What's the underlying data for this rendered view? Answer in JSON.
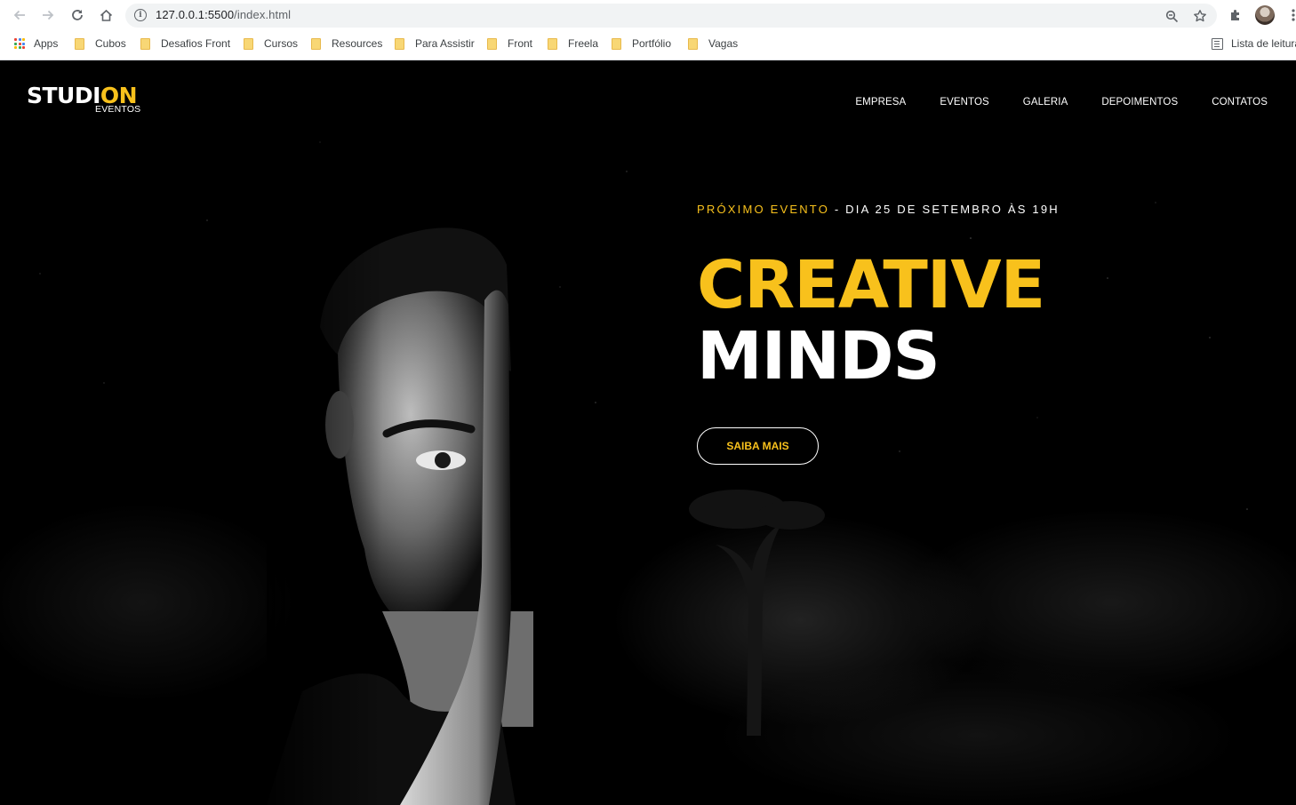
{
  "browser": {
    "url_host": "127.0.0.1:5500",
    "url_path": "/index.html",
    "bookmarks": [
      {
        "label": "Apps",
        "icon": "apps-grid-icon"
      },
      {
        "label": "Cubos",
        "icon": "folder-icon"
      },
      {
        "label": "Desafios Front",
        "icon": "folder-icon"
      },
      {
        "label": "Cursos",
        "icon": "folder-icon"
      },
      {
        "label": "Resources",
        "icon": "folder-icon"
      },
      {
        "label": "Para Assistir",
        "icon": "folder-icon"
      },
      {
        "label": "Front",
        "icon": "folder-icon"
      },
      {
        "label": "Freela",
        "icon": "folder-icon"
      },
      {
        "label": "Portfólio",
        "icon": "folder-icon"
      },
      {
        "label": "Vagas",
        "icon": "folder-icon"
      }
    ],
    "reading_list": "Lista de leitura"
  },
  "site": {
    "logo_part1": "STUDI",
    "logo_part2": "ON",
    "logo_sub": "EVENTOS",
    "menu": [
      "EMPRESA",
      "EVENTOS",
      "GALERIA",
      "DEPOIMENTOS",
      "CONTATOS"
    ],
    "eyebrow_accent": "PRÓXIMO EVENTO",
    "eyebrow_rest": " - DIA 25 DE SETEMBRO ÀS 19H",
    "headline_line1": "CREATIVE",
    "headline_line2": "MINDS",
    "cta_label": "SAIBA MAIS"
  },
  "colors": {
    "accent": "#f8c11c",
    "background": "#000000",
    "text": "#ffffff"
  }
}
